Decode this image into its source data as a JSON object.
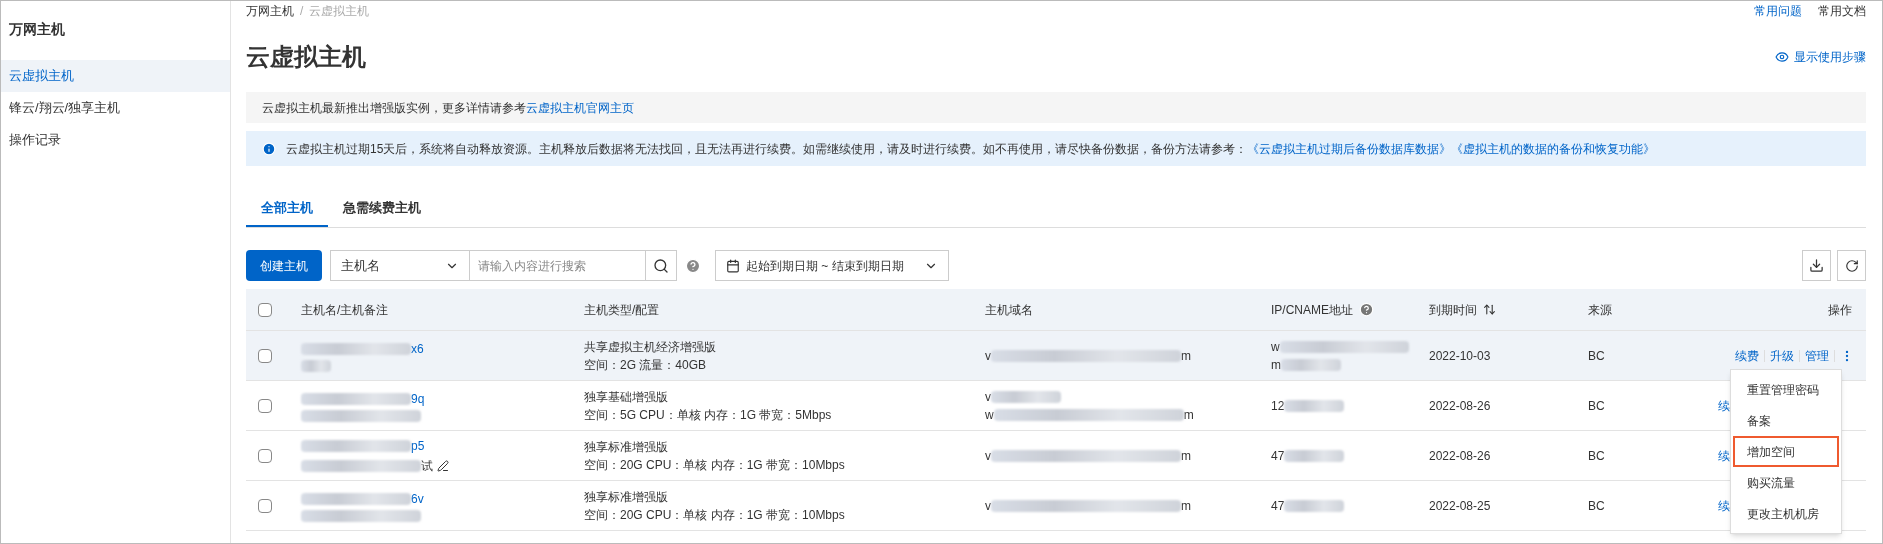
{
  "sidebar": {
    "title": "万网主机",
    "items": [
      {
        "label": "云虚拟主机",
        "selected": true
      },
      {
        "label": "锋云/翔云/独享主机",
        "selected": false
      },
      {
        "label": "操作记录",
        "selected": false
      }
    ]
  },
  "breadcrumb": [
    "万网主机",
    "/",
    "云虚拟主机"
  ],
  "top_links": [
    "常用问题",
    "常用文档"
  ],
  "page_title": "云虚拟主机",
  "show_steps": "显示使用步骤",
  "notice": {
    "text": "云虚拟主机最新推出增强版实例，更多详情请参考",
    "link": "云虚拟主机官网主页"
  },
  "alert": {
    "text": "云虚拟主机过期15天后，系统将自动释放资源。主机释放后数据将无法找回，且无法再进行续费。如需继续使用，请及时进行续费。如不再使用，请尽快备份数据，备份方法请参考：",
    "links": [
      "《云虚拟主机过期后备份数据库数据》",
      "《虚拟主机的数据的备份和恢复功能》"
    ]
  },
  "tabs": [
    {
      "label": "全部主机",
      "selected": true
    },
    {
      "label": "急需续费主机",
      "selected": false
    }
  ],
  "toolbar": {
    "create": "创建主机",
    "filter_field": "主机名",
    "search_placeholder": "请输入内容进行搜索",
    "date_range": "起始到期日期 ~ 结束到期日期"
  },
  "table": {
    "select_all_checked": false,
    "columns": [
      "主机名/主机备注",
      "主机类型/配置",
      "主机域名",
      "IP/CNAME地址",
      "到期时间",
      "来源",
      "操作"
    ],
    "rows": [
      {
        "checked": false,
        "hovered": true,
        "name_tail": "x6",
        "type": "共享虚拟主机经济增强版",
        "config": "空间：2G 流量：40GB",
        "domains": [
          {
            "head": "v",
            "tail": "m"
          }
        ],
        "ip": [
          {
            "head": "w"
          },
          {
            "head": "m"
          }
        ],
        "expiry": "2022-10-03",
        "source": "BC",
        "actions": [
          "续费",
          "升级",
          "管理"
        ]
      },
      {
        "checked": false,
        "hovered": false,
        "name_tail": "9q",
        "type": "独享基础增强版",
        "config": "空间：5G CPU：单核 内存：1G 带宽：5Mbps",
        "domains": [
          {
            "head": "v"
          },
          {
            "head": "w",
            "tail": "m"
          }
        ],
        "ip": [
          {
            "head": "12"
          }
        ],
        "expiry": "2022-08-26",
        "source": "BC",
        "actions": [
          "续"
        ]
      },
      {
        "checked": false,
        "hovered": false,
        "name_tail": "p5",
        "remark_tail": "试",
        "type": "独享标准增强版",
        "config": "空间：20G CPU：单核 内存：1G 带宽：10Mbps",
        "domains": [
          {
            "head": "v",
            "tail": "m"
          }
        ],
        "ip": [
          {
            "head": "47"
          }
        ],
        "expiry": "2022-08-26",
        "source": "BC",
        "actions": [
          "续"
        ]
      },
      {
        "checked": false,
        "hovered": false,
        "name_tail": "6v",
        "type": "独享标准增强版",
        "config": "空间：20G CPU：单核 内存：1G 带宽：10Mbps",
        "domains": [
          {
            "head": "v",
            "tail": "m"
          }
        ],
        "ip": [
          {
            "head": "47"
          }
        ],
        "expiry": "2022-08-25",
        "source": "BC",
        "actions": [
          "续"
        ]
      }
    ]
  },
  "more_menu": {
    "items": [
      {
        "label": "重置管理密码",
        "highlighted": false
      },
      {
        "label": "备案",
        "highlighted": false
      },
      {
        "label": "增加空间",
        "highlighted": true
      },
      {
        "label": "购买流量",
        "highlighted": false
      },
      {
        "label": "更改主机机房",
        "highlighted": false
      }
    ]
  }
}
